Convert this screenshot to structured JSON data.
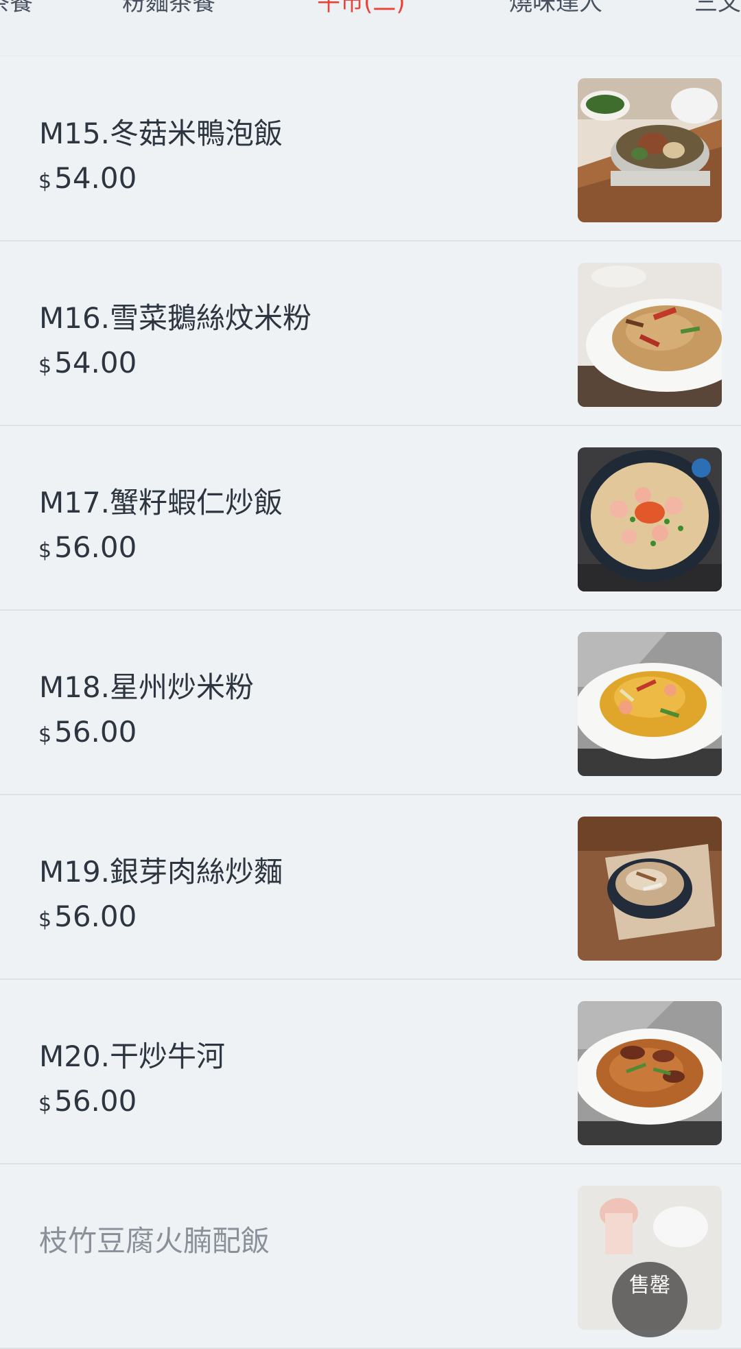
{
  "tabs": [
    {
      "label": "茶餐"
    },
    {
      "label": "粉麵茶餐"
    },
    {
      "label": "午市(二)"
    },
    {
      "label": "燒味達人"
    },
    {
      "label": "三文"
    }
  ],
  "active_tab_index": 2,
  "currency_symbol": "$",
  "items": [
    {
      "name": "M15.冬菇米鴨泡飯",
      "price": "54.00",
      "image": "clay-pot-duck-rice"
    },
    {
      "name": "M16.雪菜鵝絲炆米粉",
      "price": "54.00",
      "image": "braised-vermicelli"
    },
    {
      "name": "M17.蟹籽蝦仁炒飯",
      "price": "56.00",
      "image": "shrimp-fried-rice"
    },
    {
      "name": "M18.星州炒米粉",
      "price": "56.00",
      "image": "singapore-noodles"
    },
    {
      "name": "M19.銀芽肉絲炒麵",
      "price": "56.00",
      "image": "fried-noodles-bowl"
    },
    {
      "name": "M20.干炒牛河",
      "price": "56.00",
      "image": "beef-chow-fun"
    }
  ],
  "soldout_item": {
    "name": "枝竹豆腐火腩配飯",
    "badge": "售罄",
    "image": "tofu-pork-rice"
  },
  "colors": {
    "background": "#eff2f5",
    "text": "#2d3540",
    "active_tab": "#e8423a",
    "divider": "#dde2e7"
  }
}
